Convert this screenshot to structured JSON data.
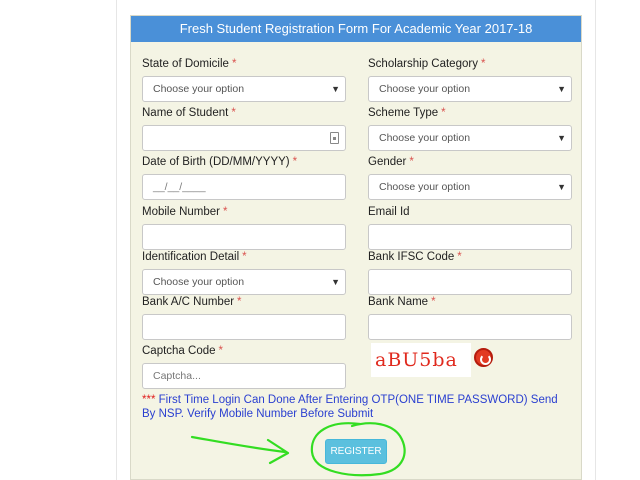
{
  "form": {
    "header": "Fresh Student Registration Form For Academic Year 2017-18",
    "required_mark": "*",
    "state_of_domicile": {
      "label": "State of Domicile",
      "value": "Choose your option"
    },
    "scholarship_category": {
      "label": "Scholarship Category",
      "value": "Choose your option"
    },
    "name_of_student": {
      "label": "Name of Student",
      "value": ""
    },
    "scheme_type": {
      "label": "Scheme Type",
      "value": "Choose your option"
    },
    "date_of_birth": {
      "label": "Date of Birth (DD/MM/YYYY)",
      "value": "__/__/____"
    },
    "gender": {
      "label": "Gender",
      "value": "Choose your option"
    },
    "mobile_number": {
      "label": "Mobile Number",
      "value": ""
    },
    "email_id": {
      "label": "Email Id",
      "value": ""
    },
    "identification_detail": {
      "label": "Identification Detail",
      "value": "Choose your option"
    },
    "bank_ifsc_code": {
      "label": "Bank IFSC Code",
      "value": ""
    },
    "bank_ac_number": {
      "label": "Bank A/C Number",
      "value": ""
    },
    "bank_name": {
      "label": "Bank Name",
      "value": ""
    },
    "captcha": {
      "label": "Captcha Code",
      "placeholder": "Captcha...",
      "image_text": "aBU5ba"
    },
    "notice_stars": "***",
    "notice_text": "First Time Login Can Done After Entering OTP(ONE TIME PASSWORD) Send By NSP. Verify Mobile Number Before Submit",
    "register_label": "REGISTER"
  },
  "icons": {
    "select_arrow": "chevron-down-icon",
    "captcha_refresh": "refresh-icon",
    "autofill": "contact-card-icon"
  },
  "colors": {
    "header_bg": "#4a90d8",
    "panel_bg": "#f4f4e4",
    "required": "#d9534f",
    "notice": "#2a3fd0",
    "register_bg": "#5bc0de",
    "annotation": "#33dd22"
  }
}
